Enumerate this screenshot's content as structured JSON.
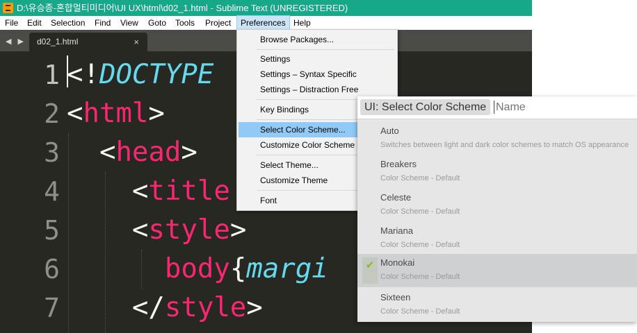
{
  "window": {
    "title": "D:\\유승종-혼합멀티미디어\\UI UX\\html\\d02_1.html - Sublime Text (UNREGISTERED)"
  },
  "menubar": [
    "File",
    "Edit",
    "Selection",
    "Find",
    "View",
    "Goto",
    "Tools",
    "Project",
    "Preferences",
    "Help"
  ],
  "tabs": {
    "nav": "◀ ▶",
    "active_tab": "d02_1.html",
    "close": "×"
  },
  "editor": {
    "line_numbers": [
      "1",
      "2",
      "3",
      "4",
      "5",
      "6",
      "7"
    ],
    "lines": [
      [
        {
          "t": "<!",
          "c": "punc"
        },
        {
          "t": "DOCTYPE",
          "c": "doctype"
        }
      ],
      [
        {
          "t": "<",
          "c": "punc"
        },
        {
          "t": "html",
          "c": "tag"
        },
        {
          "t": ">",
          "c": "punc"
        }
      ],
      [
        {
          "t": "  <",
          "c": "punc"
        },
        {
          "t": "head",
          "c": "tag"
        },
        {
          "t": ">",
          "c": "punc"
        }
      ],
      [
        {
          "t": "    <",
          "c": "punc"
        },
        {
          "t": "title",
          "c": "tag"
        }
      ],
      [
        {
          "t": "    <",
          "c": "punc"
        },
        {
          "t": "style",
          "c": "tag"
        },
        {
          "t": ">",
          "c": "punc"
        }
      ],
      [
        {
          "t": "      ",
          "c": "punc"
        },
        {
          "t": "body",
          "c": "tag"
        },
        {
          "t": "{",
          "c": "punc"
        },
        {
          "t": "margi",
          "c": "prop"
        }
      ],
      [
        {
          "t": "    </",
          "c": "punc"
        },
        {
          "t": "style",
          "c": "tag"
        },
        {
          "t": ">",
          "c": "punc"
        }
      ]
    ],
    "colors": {
      "background": "#272822",
      "tag": "#f92672",
      "keyword": "#66d9ef",
      "text": "#f8f8f2"
    }
  },
  "preferences_menu": {
    "items": [
      "Browse Packages...",
      "Settings",
      "Settings – Syntax Specific",
      "Settings – Distraction Free",
      "Key Bindings",
      "Select Color Scheme...",
      "Customize Color Scheme",
      "Select Theme...",
      "Customize Theme",
      "Font"
    ],
    "highlighted": "Select Color Scheme..."
  },
  "command_palette": {
    "badge": "UI: Select Color Scheme",
    "placeholder": "Name",
    "items": [
      {
        "name": "Auto",
        "description": "Switches between light and dark color schemes to match OS appearance"
      },
      {
        "name": "Breakers",
        "description": "Color Scheme - Default"
      },
      {
        "name": "Celeste",
        "description": "Color Scheme - Default"
      },
      {
        "name": "Mariana",
        "description": "Color Scheme - Default"
      },
      {
        "name": "Monokai",
        "description": "Color Scheme - Default",
        "selected": true,
        "check": "✔"
      },
      {
        "name": "Sixteen",
        "description": "Color Scheme - Default"
      }
    ]
  },
  "icons": {
    "app": "sublime-text-icon",
    "checkmark": "check-icon"
  }
}
